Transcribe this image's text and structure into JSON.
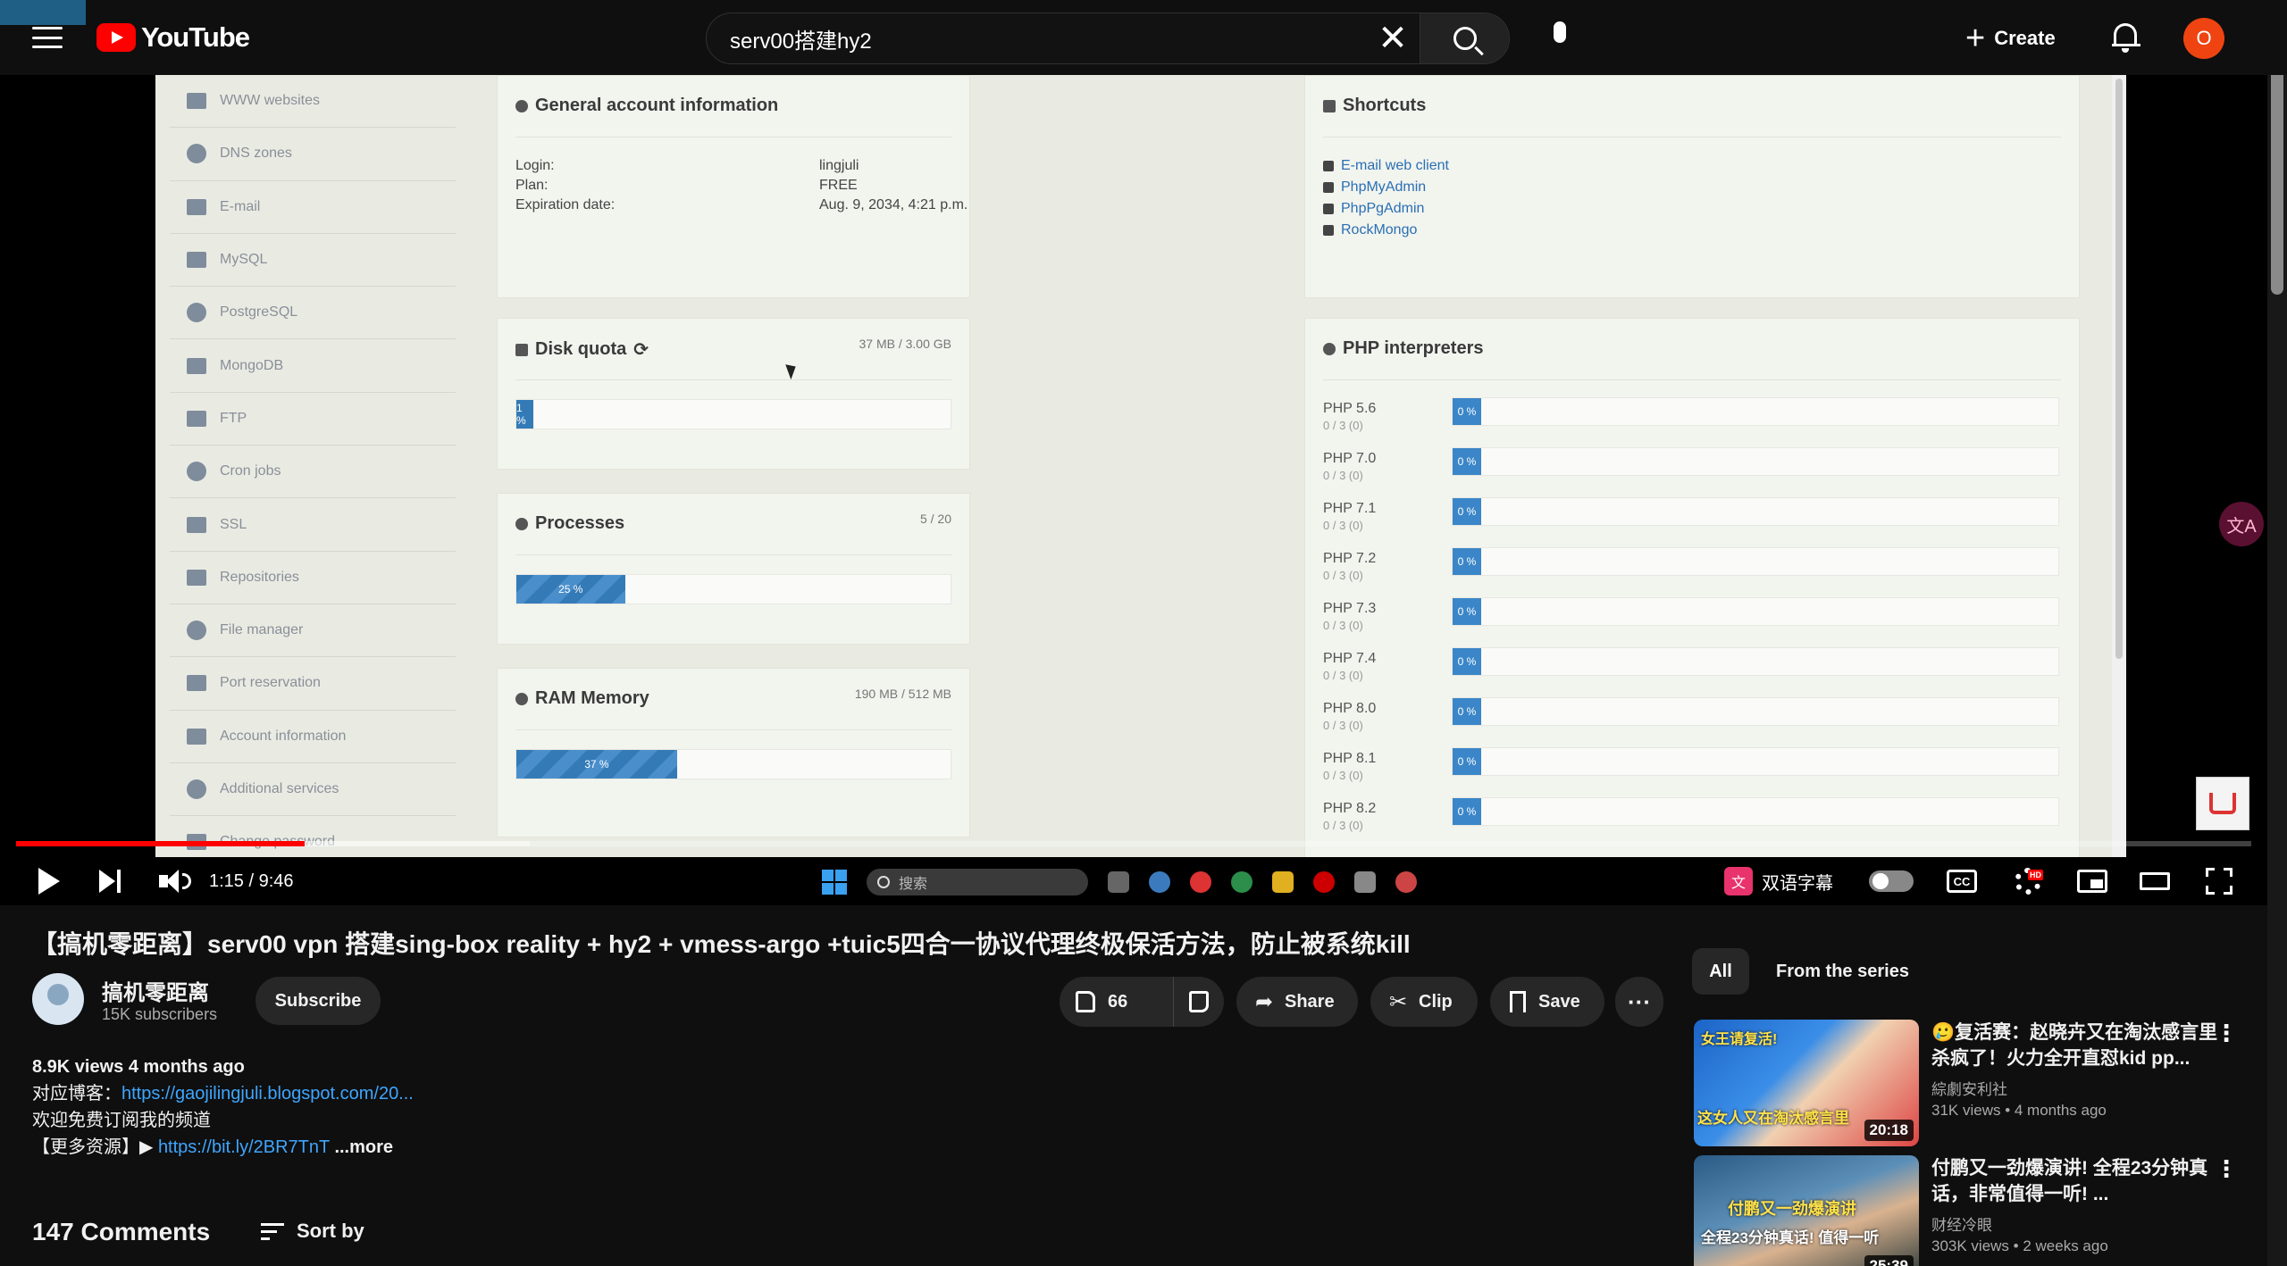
{
  "header": {
    "logo_text": "YouTube",
    "search_query": "serv00搭建hy2",
    "create_label": "Create",
    "avatar_letter": "O"
  },
  "video_frame": {
    "side_nav": [
      {
        "label": "WWW websites",
        "icon": "grid-icon"
      },
      {
        "label": "DNS zones",
        "icon": "globe-icon"
      },
      {
        "label": "E-mail",
        "icon": "envelope-icon"
      },
      {
        "label": "MySQL",
        "icon": "dolphin-icon"
      },
      {
        "label": "PostgreSQL",
        "icon": "elephant-icon"
      },
      {
        "label": "MongoDB",
        "icon": "database-icon"
      },
      {
        "label": "FTP",
        "icon": "folder-icon"
      },
      {
        "label": "Cron jobs",
        "icon": "calendar-icon"
      },
      {
        "label": "SSL",
        "icon": "lock-icon"
      },
      {
        "label": "Repositories",
        "icon": "branch-icon"
      },
      {
        "label": "File manager",
        "icon": "folder-open-icon"
      },
      {
        "label": "Port reservation",
        "icon": "plug-icon"
      },
      {
        "label": "Account information",
        "icon": "user-icon"
      },
      {
        "label": "Additional services",
        "icon": "asterisk-icon"
      },
      {
        "label": "Change password",
        "icon": "key-icon"
      }
    ],
    "general": {
      "title": "General account information",
      "rows": [
        {
          "label": "Login:",
          "value": "lingjuli"
        },
        {
          "label": "Plan:",
          "value": "FREE"
        },
        {
          "label": "Expiration date:",
          "value": "Aug. 9, 2034, 4:21 p.m."
        }
      ]
    },
    "shortcuts": {
      "title": "Shortcuts",
      "items": [
        "E-mail web client",
        "PhpMyAdmin",
        "PhpPgAdmin",
        "RockMongo"
      ]
    },
    "disk": {
      "title": "Disk quota",
      "meta": "37 MB / 3.00 GB",
      "percent_label": "1 %",
      "percent": 1
    },
    "processes": {
      "title": "Processes",
      "meta": "5 / 20",
      "percent_label": "25 %",
      "percent": 25
    },
    "ram": {
      "title": "RAM Memory",
      "meta": "190 MB / 512 MB",
      "percent_label": "37 %",
      "percent": 37
    },
    "php": {
      "title": "PHP interpreters",
      "items": [
        {
          "name": "PHP 5.6",
          "count": "0 / 3 (0)",
          "percent": "0 %"
        },
        {
          "name": "PHP 7.0",
          "count": "0 / 3 (0)",
          "percent": "0 %"
        },
        {
          "name": "PHP 7.1",
          "count": "0 / 3 (0)",
          "percent": "0 %"
        },
        {
          "name": "PHP 7.2",
          "count": "0 / 3 (0)",
          "percent": "0 %"
        },
        {
          "name": "PHP 7.3",
          "count": "0 / 3 (0)",
          "percent": "0 %"
        },
        {
          "name": "PHP 7.4",
          "count": "0 / 3 (0)",
          "percent": "0 %"
        },
        {
          "name": "PHP 8.0",
          "count": "0 / 3 (0)",
          "percent": "0 %"
        },
        {
          "name": "PHP 8.1",
          "count": "0 / 3 (0)",
          "percent": "0 %"
        },
        {
          "name": "PHP 8.2",
          "count": "0 / 3 (0)",
          "percent": "0 %"
        }
      ]
    }
  },
  "player": {
    "time": "1:15 / 9:46",
    "played_fraction": 0.129,
    "loaded_fraction": 0.23,
    "taskbar_search": "搜索",
    "subtitle_label": "双语字幕",
    "side_badge": "文A"
  },
  "video": {
    "title": "【搞机零距离】serv00 vpn 搭建sing-box reality + hy2 + vmess-argo +tuic5四合一协议代理终极保活方法，防止被系统kill",
    "channel": "搞机零距离",
    "subscribers": "15K subscribers",
    "subscribe_label": "Subscribe",
    "likes": "66",
    "share_label": "Share",
    "clip_label": "Clip",
    "save_label": "Save",
    "more_label": "···"
  },
  "description": {
    "stats": "8.9K views  4 months ago",
    "line1_prefix": "对应博客：",
    "line1_link": "https://gaojilingjuli.blogspot.com/20...",
    "line2": "欢迎免费订阅我的频道",
    "line3_prefix": "【更多资源】▶ ",
    "line3_link": "https://bit.ly/2BR7TnT",
    "more": "...more"
  },
  "comments": {
    "count_label": "147 Comments",
    "sort_label": "Sort by"
  },
  "sidebar": {
    "chips": [
      "All",
      "From the series"
    ],
    "recs": [
      {
        "title": "🥲复活赛：赵晓卉又在淘汰感言里杀疯了！火力全开直怼kid pp...",
        "channel": "綜劇安利社",
        "meta": "31K views  • 4 months ago",
        "duration": "20:18",
        "thumb_text_a": "这女人又在淘汰感言里",
        "thumb_text_b": "女王请复活!"
      },
      {
        "title": "付鹏又一劲爆演讲! 全程23分钟真话，非常值得一听! ...",
        "channel": "财经冷眼",
        "meta": "303K views  • 2 weeks ago",
        "duration": "25:39",
        "thumb_text_a": "全程23分钟真话! 值得一听",
        "thumb_text_b": "付鹏又一劲爆演讲"
      }
    ]
  }
}
